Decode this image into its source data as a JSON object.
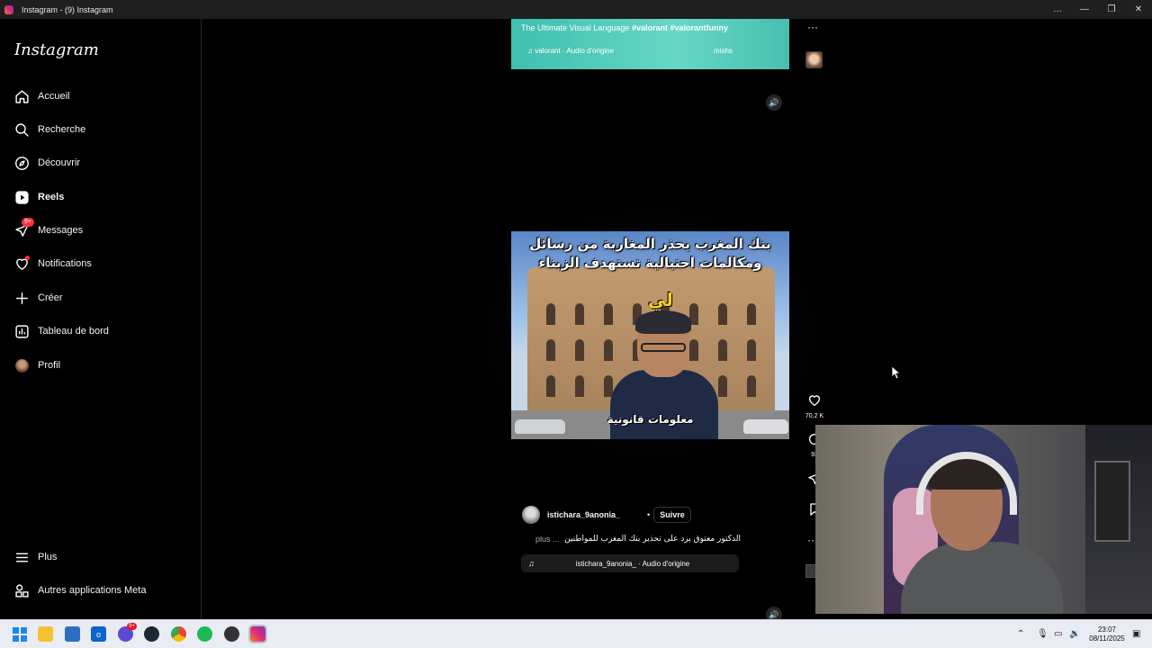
{
  "window": {
    "title": "Instagram - (9) Instagram",
    "controls": [
      "…",
      "—",
      "❐",
      "✕"
    ]
  },
  "sidebar": {
    "logo": "Instagram",
    "items": [
      {
        "label": "Accueil",
        "icon": "home-icon"
      },
      {
        "label": "Recherche",
        "icon": "search-icon"
      },
      {
        "label": "Découvrir",
        "icon": "compass-icon"
      },
      {
        "label": "Reels",
        "icon": "reels-icon"
      },
      {
        "label": "Messages",
        "icon": "messenger-icon",
        "badge": "9+"
      },
      {
        "label": "Notifications",
        "icon": "heart-icon"
      },
      {
        "label": "Créer",
        "icon": "plus-icon"
      },
      {
        "label": "Tableau de bord",
        "icon": "chart-icon"
      },
      {
        "label": "Profil",
        "icon": "avatar"
      }
    ],
    "bottom": [
      {
        "label": "Plus",
        "icon": "menu-icon"
      },
      {
        "label": "Autres applications Meta",
        "icon": "meta-apps-icon"
      }
    ]
  },
  "reel_prev": {
    "title_plain": "The Ultimate Visual Language",
    "title_tags": "#valorant #valorantfunny",
    "audio": "valorant · Audio d'origine",
    "author": "mishs"
  },
  "reel_current": {
    "headline": "بنك المغرب يحذر المغاربة من رسائل ومكالمات احتيالية تستهدف الزبناء",
    "overlay_word": "لي",
    "subtitle": "معلومات قانونية",
    "likes": "70,2 K",
    "comments": "93",
    "author": "istichara_9anonia_",
    "separator": "•",
    "follow": "Suivre",
    "caption": "الدكتور معتوق يرد على تحذير بنك المغرب للمواطنين",
    "more": "plus ...",
    "audio": "istichara_9anonia_ · Audio d'origine"
  },
  "taskbar": {
    "time": "23:07",
    "date": "08/11/2025",
    "messenger_badge": "9+"
  },
  "colors": {
    "accent_red": "#ff3040",
    "teal": "#4fcfbf",
    "taskbar": "#e9ecf2"
  }
}
